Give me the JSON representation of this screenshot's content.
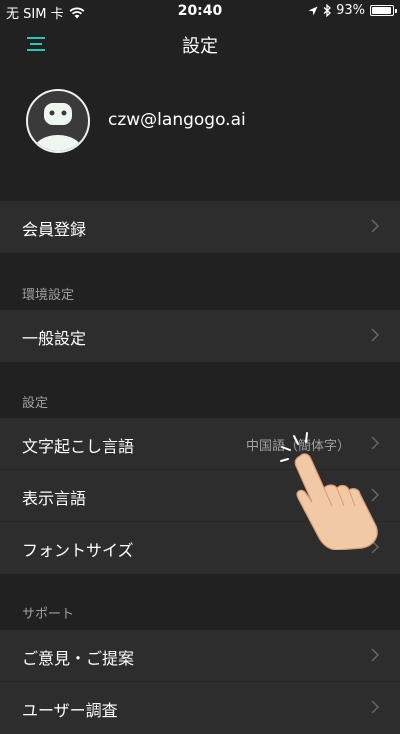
{
  "status_bar": {
    "carrier": "无 SIM 卡",
    "time": "20:40",
    "battery_percent": "93%",
    "battery_level": 0.93
  },
  "nav": {
    "title": "設定",
    "menu_icon": "menu-icon"
  },
  "profile": {
    "email": "czw@langogo.ai"
  },
  "membership": {
    "label": "会員登録"
  },
  "sections": {
    "environment": "環境設定",
    "settings": "設定",
    "support": "サポート"
  },
  "environment_items": [
    {
      "label": "一般設定"
    }
  ],
  "settings_items": [
    {
      "label": "文字起こし言語",
      "value": "中国語（簡体字）"
    },
    {
      "label": "表示言語",
      "value": ""
    },
    {
      "label": "フォントサイズ",
      "value": ""
    }
  ],
  "support_items": [
    {
      "label": "ご意見・ご提案"
    },
    {
      "label": "ユーザー調査"
    }
  ],
  "colors": {
    "background": "#212121",
    "row": "#2d2d2d",
    "accent": "#2ec4b6",
    "secondary_text": "#a0a0a0"
  }
}
